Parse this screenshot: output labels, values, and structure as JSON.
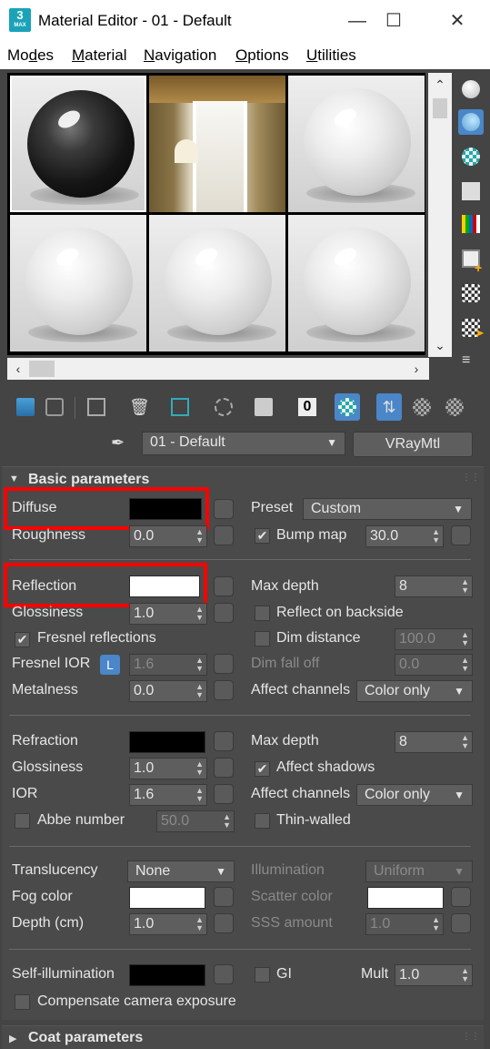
{
  "window": {
    "title": "Material Editor - 01 - Default",
    "icon_text": "3",
    "icon_sub": "MAX"
  },
  "menu": [
    "Modes",
    "Material",
    "Navigation",
    "Options",
    "Utilities"
  ],
  "material": {
    "name": "01 - Default",
    "type": "VRayMtl"
  },
  "rollouts": {
    "basic": "Basic parameters",
    "coat": "Coat parameters"
  },
  "diffuse": {
    "label": "Diffuse",
    "color": "#000000",
    "roughness_label": "Roughness",
    "roughness": "0.0",
    "preset_label": "Preset",
    "preset": "Custom",
    "bump_label": "Bump map",
    "bump": "30.0",
    "bump_checked": true
  },
  "reflection": {
    "label": "Reflection",
    "color": "#ffffff",
    "glossiness_label": "Glossiness",
    "glossiness": "1.0",
    "fresnel_label": "Fresnel reflections",
    "fresnel_checked": true,
    "fresnel_ior_label": "Fresnel IOR",
    "fresnel_ior_lock": "L",
    "fresnel_ior": "1.6",
    "metalness_label": "Metalness",
    "metalness": "0.0",
    "max_depth_label": "Max depth",
    "max_depth": "8",
    "backside_label": "Reflect on backside",
    "dim_distance_label": "Dim distance",
    "dim_distance": "100.0",
    "dim_falloff_label": "Dim fall off",
    "dim_falloff": "0.0",
    "affect_label": "Affect channels",
    "affect": "Color only"
  },
  "refraction": {
    "label": "Refraction",
    "color": "#000000",
    "glossiness_label": "Glossiness",
    "glossiness": "1.0",
    "ior_label": "IOR",
    "ior": "1.6",
    "abbe_label": "Abbe number",
    "abbe": "50.0",
    "max_depth_label": "Max depth",
    "max_depth": "8",
    "shadows_label": "Affect shadows",
    "shadows_checked": true,
    "affect_label": "Affect channels",
    "affect": "Color only",
    "thin_label": "Thin-walled"
  },
  "translucency": {
    "label": "Translucency",
    "value": "None",
    "fog_label": "Fog color",
    "fog_color": "#ffffff",
    "depth_label": "Depth (cm)",
    "depth": "1.0",
    "illum_label": "Illumination",
    "illum": "Uniform",
    "scatter_label": "Scatter color",
    "scatter_color": "#ffffff",
    "sss_label": "SSS amount",
    "sss": "1.0"
  },
  "selfillum": {
    "label": "Self-illumination",
    "color": "#000000",
    "gi_label": "GI",
    "mult_label": "Mult",
    "mult": "1.0",
    "compensate_label": "Compensate camera exposure"
  },
  "colors": {
    "highlight": "#ff0000",
    "accent": "#4a86c8"
  }
}
